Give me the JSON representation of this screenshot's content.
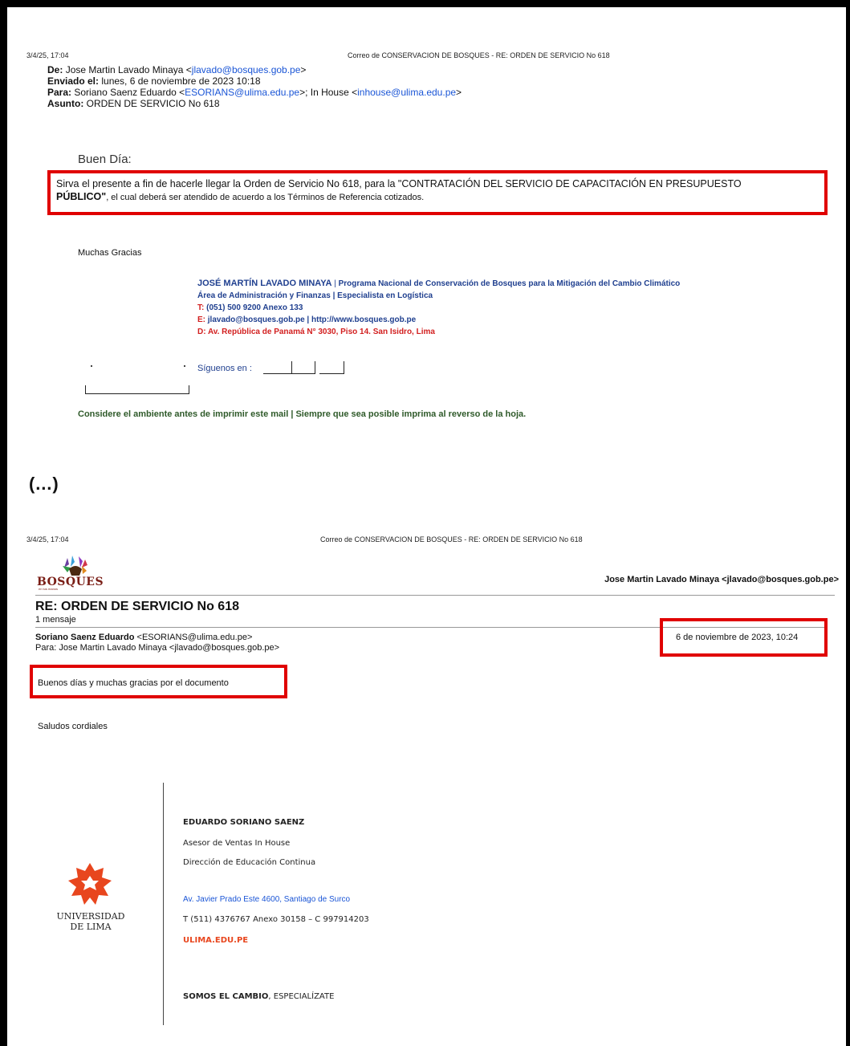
{
  "page1": {
    "print_date": "3/4/25, 17:04",
    "print_title": "Correo de CONSERVACION DE BOSQUES - RE: ORDEN DE SERVICIO No 618",
    "from_label": "De:",
    "from_name": "Jose Martin Lavado Minaya <",
    "from_email": "jlavado@bosques.gob.pe",
    "from_close": ">",
    "sent_label": "Enviado el:",
    "sent_value": "lunes, 6 de noviembre de 2023 10:18",
    "to_label": "Para:",
    "to_name1": "Soriano Saenz Eduardo <",
    "to_email1": "ESORIANS@ulima.edu.pe",
    "to_mid": ">; In House <",
    "to_email2": "inhouse@ulima.edu.pe",
    "to_close": ">",
    "subject_label": "Asunto:",
    "subject_value": "ORDEN DE SERVICIO No 618",
    "greeting": "Buen Día:",
    "body_line1": "Sirva el presente a fin de hacerle llegar la Orden de Servicio No 618, para la \"CONTRATACIÓN DEL SERVICIO DE CAPACITACIÓN EN PRESUPUESTO",
    "body_line2a": "PÚBLICO\"",
    "body_line2b": ", el cual deberá ser atendido de acuerdo a los Términos de Referencia cotizados.",
    "thanks": "Muchas Gracias",
    "sig_name": "JOSÉ MARTÍN LAVADO MINAYA",
    "sig_sep": " | ",
    "sig_program": "Programa Nacional de Conservación de Bosques para la Mitigación del Cambio Climático",
    "sig_area": "Área de Administración y Finanzas | Especialista en Logística",
    "sig_phone_label": "T:",
    "sig_phone": " (051) 500 9200 Anexo 133",
    "sig_email_label": "E:",
    "sig_email": " jlavado@bosques.gob.pe | http://www.bosques.gob.pe",
    "sig_address": "D: Av. República de Panamá N° 3030, Piso 14. San Isidro, Lima",
    "follow": "Síguenos en :",
    "footer_note": "Considere el ambiente antes de imprimir este mail | Siempre que sea posible imprima al reverso de la hoja."
  },
  "ellipsis": "(…)",
  "page2": {
    "print_date": "3/4/25, 17:04",
    "print_title": "Correo de CONSERVACION DE BOSQUES - RE: ORDEN DE SERVICIO No 618",
    "logo_text": "BOSQUES",
    "logo_tagline": "en tus manos",
    "account": "Jose Martin Lavado Minaya <jlavado@bosques.gob.pe>",
    "subject": "RE: ORDEN DE SERVICIO No 618",
    "count": "1 mensaje",
    "sender_name": "Soriano Saenz Eduardo",
    "sender_email": " <ESORIANS@ulima.edu.pe>",
    "recipient": "Para: Jose Martin Lavado Minaya <jlavado@bosques.gob.pe>",
    "date": "6 de noviembre de 2023, 10:24",
    "body": "Buenos días y muchas gracias por el documento",
    "closing": "Saludos cordiales",
    "uni_name_line1": "UNIVERSIDAD",
    "uni_name_line2": "DE LIMA",
    "sig_name": "EDUARDO SORIANO SAENZ",
    "sig_role": "Asesor de Ventas In House",
    "sig_dept": "Dirección de Educación Continua",
    "sig_address": "Av. Javier Prado Este 4600, Santiago de Surco",
    "sig_phone": "T (511) 4376767 Anexo 30158 – C 997914203",
    "sig_web": "ULIMA.EDU.PE",
    "slogan_bold": "SOMOS EL CAMBIO",
    "slogan_rest": ", ESPECIALÍZATE"
  },
  "colors": {
    "highlight": "#e00000",
    "link": "#1a55d6",
    "signature_blue": "#1f3f8f",
    "ulima_orange": "#e8461e",
    "footer_green": "#2f5a2a"
  }
}
